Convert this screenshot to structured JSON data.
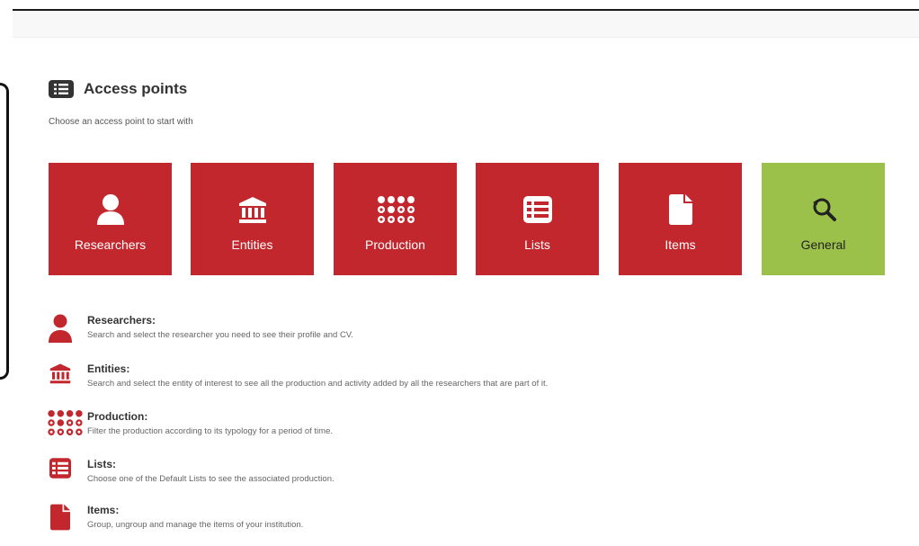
{
  "header": {
    "title": "Access points",
    "subtitle": "Choose an access point to start with"
  },
  "colors": {
    "tile_red": "#c1272d",
    "tile_green": "#9cc14a",
    "heading": "#333333"
  },
  "tiles": [
    {
      "label": "Researchers",
      "icon": "user-icon"
    },
    {
      "label": "Entities",
      "icon": "institution-icon"
    },
    {
      "label": "Production",
      "icon": "dots-grid-icon"
    },
    {
      "label": "Lists",
      "icon": "list-icon"
    },
    {
      "label": "Items",
      "icon": "file-icon"
    },
    {
      "label": "General",
      "icon": "search-history-icon"
    }
  ],
  "descriptions": [
    {
      "title": "Researchers:",
      "text": "Search and select the researcher you need to see their profile and CV.",
      "icon": "user-icon"
    },
    {
      "title": "Entities:",
      "text": "Search and select the entity of interest to see all the production and activity added by all the researchers that are part of it.",
      "icon": "institution-icon"
    },
    {
      "title": "Production:",
      "text": "Filter the production according to its typology for a period of time.",
      "icon": "dots-grid-icon"
    },
    {
      "title": "Lists:",
      "text": "Choose one of the Default Lists to see the associated production.",
      "icon": "list-icon"
    },
    {
      "title": "Items:",
      "text": "Group, ungroup and manage the items of your institution.",
      "icon": "file-icon"
    }
  ]
}
